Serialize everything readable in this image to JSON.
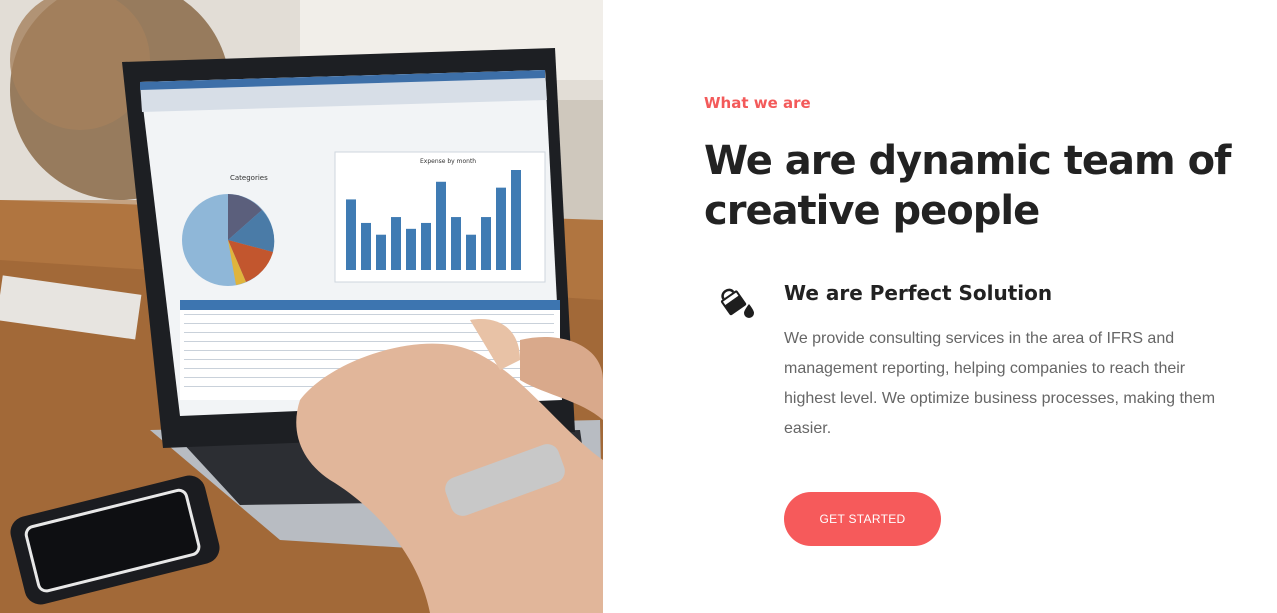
{
  "hero_image": {
    "alt": "laptop showing spreadsheet dashboard",
    "screen": {
      "pie_title": "Categories",
      "bar_title": "Expense by month",
      "bars": [
        6,
        4,
        3,
        4.5,
        3.5,
        4,
        7.5,
        4.5,
        3,
        4.5,
        7,
        8.5
      ]
    }
  },
  "section": {
    "eyebrow": "What we are",
    "headline": "We are dynamic team of creative people",
    "feature": {
      "icon": "paint-bucket-icon",
      "title": "We are Perfect Solution",
      "description": "We provide consulting services in the area of IFRS and management reporting, helping companies to reach their highest level. We optimize business processes, making them easier."
    },
    "cta_label": "GET STARTED"
  },
  "colors": {
    "accent": "#f65a5b",
    "heading": "#222222",
    "body_text": "#666666"
  }
}
